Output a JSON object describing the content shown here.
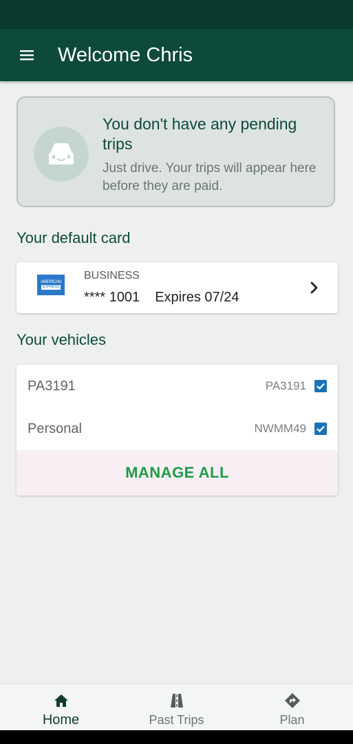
{
  "header": {
    "title": "Welcome Chris",
    "menu_icon": "hamburger-menu-icon"
  },
  "pending": {
    "icon": "car-icon",
    "title": "You don't have any pending trips",
    "subtitle": "Just drive. Your trips will appear here before they are paid."
  },
  "default_card": {
    "section_title": "Your default card",
    "type": "BUSINESS",
    "number": "**** 1001",
    "expires": "Expires 07/24",
    "logo_lines": [
      "AMERICAN",
      "EXPRESS"
    ],
    "chevron_icon": "chevron-right-icon"
  },
  "vehicles": {
    "section_title": "Your vehicles",
    "items": [
      {
        "name": "PA3191",
        "plate": "PA3191",
        "checked": true
      },
      {
        "name": "Personal",
        "plate": "NWMM49",
        "checked": true
      }
    ],
    "manage_label": "MANAGE ALL"
  },
  "nav": {
    "items": [
      {
        "label": "Home",
        "icon": "home-icon",
        "active": true
      },
      {
        "label": "Past Trips",
        "icon": "road-icon",
        "active": false
      },
      {
        "label": "Plan",
        "icon": "directions-icon",
        "active": false
      }
    ]
  },
  "colors": {
    "primary": "#0e4a3c",
    "accent_green": "#1f9a45",
    "checkbox_blue": "#1a73b8",
    "amex_blue": "#2a79c8"
  }
}
